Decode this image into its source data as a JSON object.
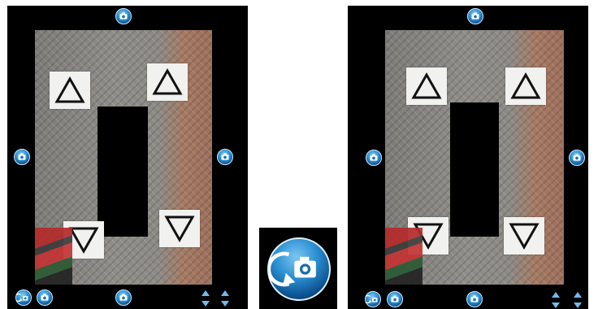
{
  "panels": [
    {
      "id": "left",
      "label": ""
    },
    {
      "id": "right",
      "label": ""
    }
  ],
  "icons": {
    "camera_button": "camera-icon",
    "rotate_camera_button": "rotate-camera-icon",
    "updown_arrows": "up-down-arrows-icon"
  },
  "colors": {
    "button_blue": "#2a8fd0",
    "panel_background": "#000000",
    "sheet": "#f1f1ef"
  }
}
